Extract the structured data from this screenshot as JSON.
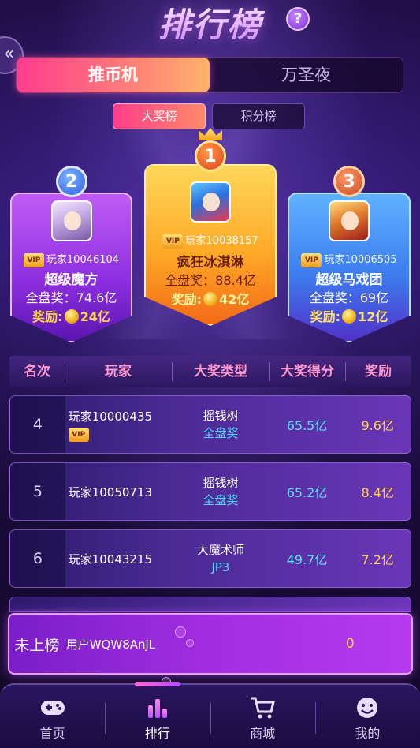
{
  "header": {
    "title": "排行榜",
    "help_symbol": "?",
    "back_symbol": "«"
  },
  "main_tabs": [
    {
      "label": "推币机",
      "active": true
    },
    {
      "label": "万圣夜",
      "active": false
    }
  ],
  "sub_tabs": [
    {
      "label": "大奖榜",
      "active": true
    },
    {
      "label": "积分榜",
      "active": false
    }
  ],
  "podium": {
    "first": {
      "rank": "1",
      "player": "玩家10038157",
      "title": "疯狂冰淇淋",
      "prize": "全盘奖：88.4亿",
      "reward_label": "奖励:",
      "reward_value": "42亿",
      "vip": "VIP"
    },
    "second": {
      "rank": "2",
      "player": "玩家10046104",
      "title": "超级魔方",
      "prize": "全盘奖：74.6亿",
      "reward_label": "奖励:",
      "reward_value": "24亿",
      "vip": "VIP"
    },
    "third": {
      "rank": "3",
      "player": "玩家10006505",
      "title": "超级马戏团",
      "prize": "全盘奖：69亿",
      "reward_label": "奖励:",
      "reward_value": "12亿",
      "vip": "VIP"
    }
  },
  "table": {
    "headers": [
      "名次",
      "玩家",
      "大奖类型",
      "大奖得分",
      "奖励"
    ],
    "rows": [
      {
        "rank": "4",
        "player": "玩家10000435",
        "vip": "VIP",
        "type": "摇钱树",
        "subtype": "全盘奖",
        "score": "65.5亿",
        "reward": "9.6亿"
      },
      {
        "rank": "5",
        "player": "玩家10050713",
        "type": "摇钱树",
        "subtype": "全盘奖",
        "score": "65.2亿",
        "reward": "8.4亿"
      },
      {
        "rank": "6",
        "player": "玩家10043215",
        "type": "大魔术师",
        "subtype": "JP3",
        "score": "49.7亿",
        "reward": "7.2亿"
      }
    ]
  },
  "my_rank": {
    "status": "未上榜",
    "user": "用户WQW8AnjL",
    "reward": "0"
  },
  "nav": [
    {
      "label": "首页",
      "icon": "gamepad-icon",
      "active": false
    },
    {
      "label": "排行",
      "icon": "bar-chart-icon",
      "active": true
    },
    {
      "label": "商城",
      "icon": "cart-icon",
      "active": false
    },
    {
      "label": "我的",
      "icon": "smiley-icon",
      "active": false
    }
  ],
  "colors": {
    "accent_pink": "#ff3c8e",
    "gold": "#ffd34a",
    "cyan": "#5de0ff",
    "purple": "#a22ee0"
  }
}
